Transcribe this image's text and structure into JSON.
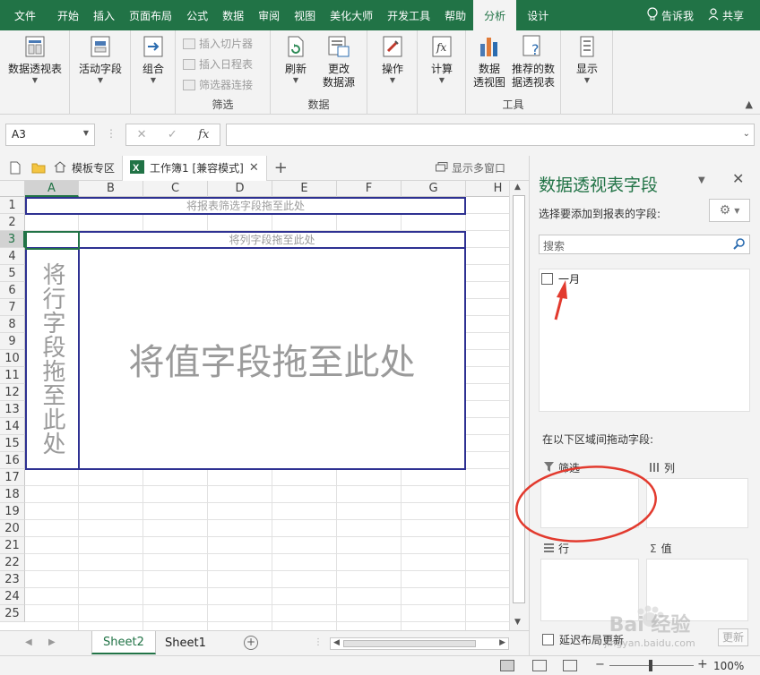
{
  "ribbon_tabs": [
    "文件",
    "开始",
    "插入",
    "页面布局",
    "公式",
    "数据",
    "审阅",
    "视图",
    "美化大师",
    "开发工具",
    "帮助",
    "分析",
    "设计"
  ],
  "ribbon_right": {
    "tell_me": "告诉我",
    "share": "共享"
  },
  "ribbon": {
    "pivot_table": "数据透视表",
    "active_field": "活动字段",
    "group": "组合",
    "insert_slicer": "插入切片器",
    "insert_timeline": "插入日程表",
    "filter_connections": "筛选器连接",
    "filter_group": "筛选",
    "refresh": "刷新",
    "change_source_1": "更改",
    "change_source_2": "数据源",
    "data_group": "数据",
    "actions": "操作",
    "calculations": "计算",
    "pivot_chart_1": "数据",
    "pivot_chart_2": "透视图",
    "recommended_1": "推荐的数",
    "recommended_2": "据透视表",
    "tools_group": "工具",
    "show": "显示"
  },
  "formula_bar": {
    "name_box": "A3",
    "fx": "fx",
    "cancel": "✕",
    "enter": "✓",
    "value": ""
  },
  "doc_tabs": {
    "template": "模板专区",
    "workbook": "工作簿1  [兼容模式]",
    "multi_window": "显示多窗口"
  },
  "grid": {
    "columns": [
      "A",
      "B",
      "C",
      "D",
      "E",
      "F",
      "G",
      "H"
    ],
    "rows": [
      "1",
      "2",
      "3",
      "4",
      "5",
      "6",
      "7",
      "8",
      "9",
      "10",
      "11",
      "12",
      "13",
      "14",
      "15",
      "16",
      "17",
      "18",
      "19",
      "20",
      "21",
      "22",
      "23",
      "24",
      "25"
    ],
    "filter_zone": "将报表筛选字段拖至此处",
    "column_zone": "将列字段拖至此处",
    "row_zone": "将行字段拖至此处",
    "value_zone": "将值字段拖至此处"
  },
  "sheets": [
    "Sheet2",
    "Sheet1"
  ],
  "status": {
    "zoom": "100%"
  },
  "pane": {
    "title": "数据透视表字段",
    "subtitle": "选择要添加到报表的字段:",
    "search_placeholder": "搜索",
    "fields": [
      "一月"
    ],
    "drag_label": "在以下区域间拖动字段:",
    "area_filters": "筛选",
    "area_columns": "列",
    "area_rows": "行",
    "area_values": "值",
    "defer": "延迟布局更新",
    "update": "更新"
  },
  "watermark": {
    "text": "Bai 经验",
    "url": "jingyan.baidu.com"
  },
  "colors": {
    "excel_green": "#217346",
    "zone_border": "#2e3192",
    "annotation_red": "#e23a2e"
  }
}
